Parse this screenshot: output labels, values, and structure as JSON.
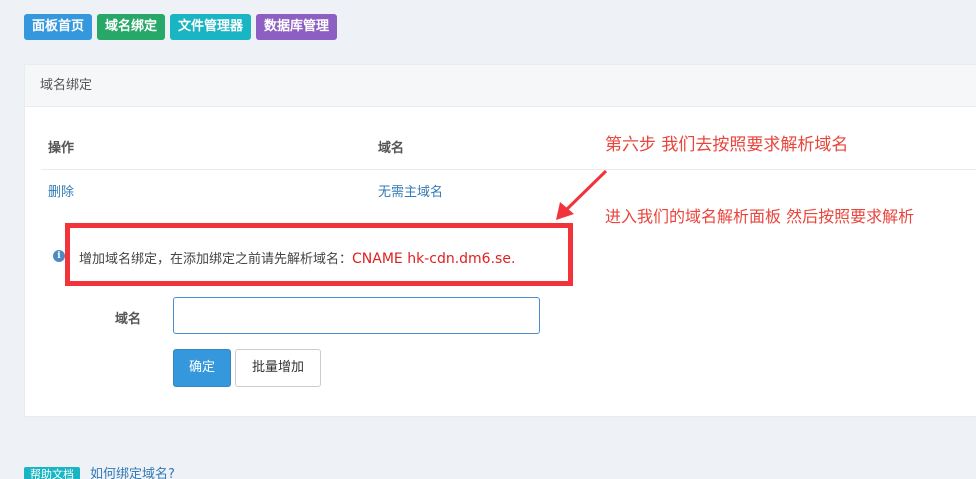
{
  "topnav": {
    "panel_home": "面板首页",
    "domain_binding": "域名绑定",
    "file_manager": "文件管理器",
    "db_manager": "数据库管理"
  },
  "panel": {
    "title": "域名绑定",
    "table": {
      "headers": [
        "操作",
        "域名"
      ],
      "rows": [
        {
          "action": "删除",
          "domain": "无需主域名"
        }
      ]
    },
    "notice": {
      "text": "增加域名绑定，在添加绑定之前请先解析域名：",
      "cname": "CNAME hk-cdn.dm6.se."
    },
    "form": {
      "label": "域名",
      "value": "",
      "confirm_label": "确定",
      "batch_label": "批量增加"
    }
  },
  "annotations": {
    "step": "第六步  我们去按照要求解析域名",
    "instruction": "进入我们的域名解析面板  然后按照要求解析"
  },
  "footer": {
    "badge": "帮助文档",
    "link": "如何绑定域名?"
  },
  "colors": {
    "accent_blue": "#3598dc",
    "green": "#27a768",
    "cyan": "#19b5c3",
    "purple": "#8e5fc2",
    "annotation_red": "#e8453c",
    "highlight_box": "#f2333a"
  }
}
